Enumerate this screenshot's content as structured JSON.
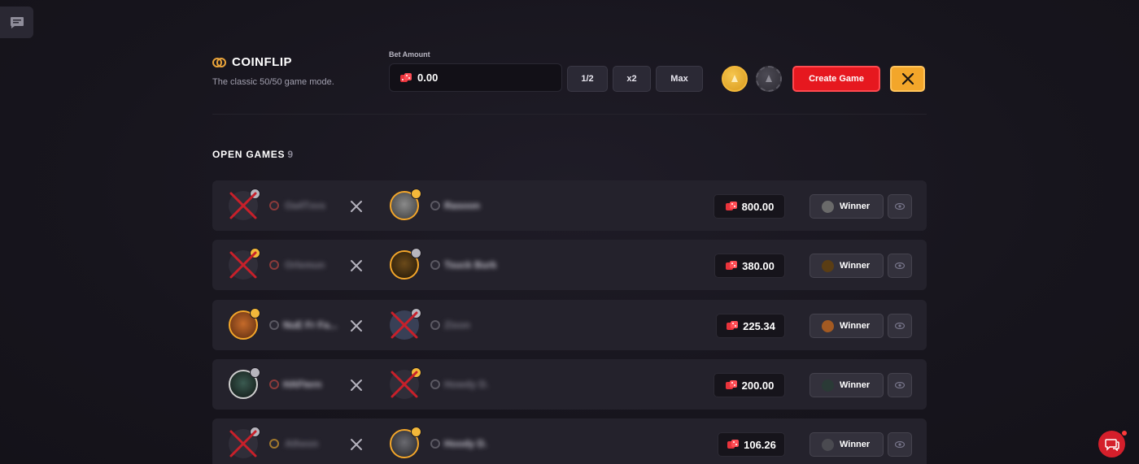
{
  "header": {
    "title": "COINFLIP",
    "subtitle": "The classic 50/50 game mode.",
    "bet_label": "Bet Amount",
    "bet_value": "0.00",
    "half_label": "1/2",
    "double_label": "x2",
    "max_label": "Max",
    "create_label": "Create Game"
  },
  "open_games": {
    "title": "OPEN GAMES",
    "count": "9",
    "rows": [
      {
        "left_name": "Oa4Txvs",
        "right_name": "Rasoon",
        "amount": "800.00",
        "winner_label": "Winner"
      },
      {
        "left_name": "Orlemun",
        "right_name": "Tsuck Burk",
        "amount": "380.00",
        "winner_label": "Winner"
      },
      {
        "left_name": "NuE Fr Fa...",
        "right_name": "Zixon",
        "amount": "225.34",
        "winner_label": "Winner"
      },
      {
        "left_name": "HAFtern",
        "right_name": "Howdy D.",
        "amount": "200.00",
        "winner_label": "Winner"
      },
      {
        "left_name": "Atheon",
        "right_name": "Hoody D.",
        "amount": "106.26",
        "winner_label": "Winner"
      }
    ]
  },
  "colors": {
    "accent_gold": "#f3a62a",
    "accent_red": "#e6181f",
    "background": "#17151d"
  },
  "icons": {
    "chat": "chat-bubble-icon",
    "coin": "coin-icon",
    "token": "red-dice-icon",
    "swords": "crossed-swords-icon",
    "eye": "eye-icon",
    "support": "support-chat-icon"
  }
}
